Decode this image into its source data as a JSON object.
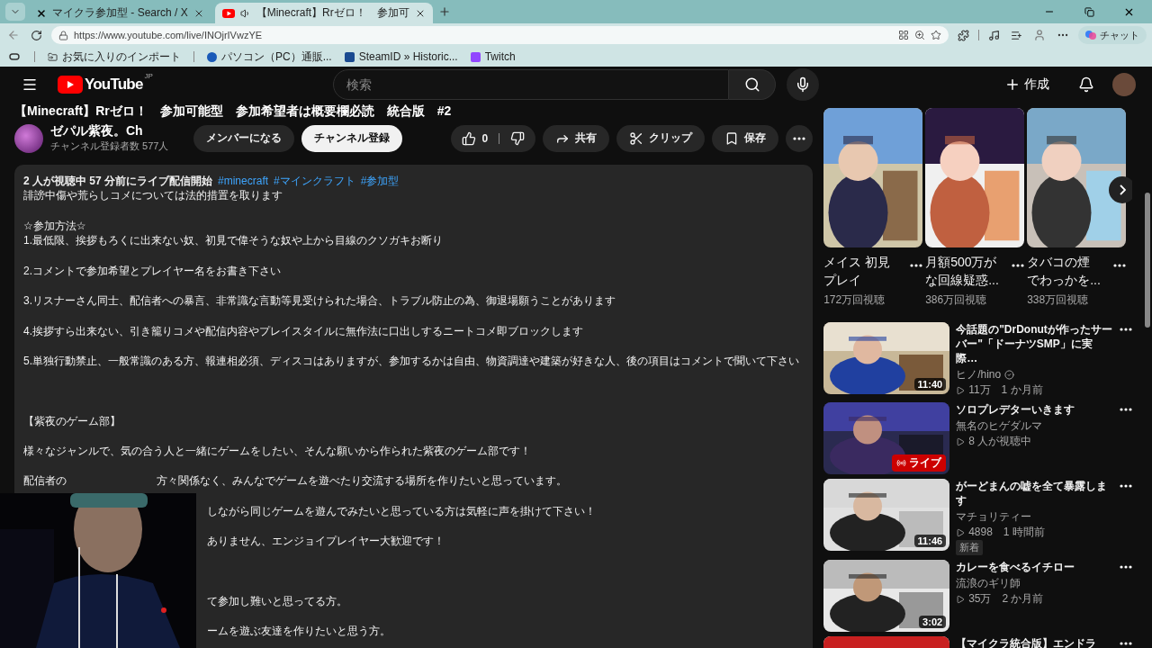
{
  "browser": {
    "tabs": [
      {
        "title": "マイクラ参加型 - Search / X",
        "selected": false,
        "audio": false
      },
      {
        "title": "【Minecraft】Rrゼロ！　参加可",
        "selected": true,
        "audio": true
      }
    ],
    "url": "https://www.youtube.com/live/INOjrIVwzYE",
    "chat_label": "チャット",
    "bookmarks": [
      "お気に入りのインポート",
      "パソコン（PC）通販...",
      "SteamID » Historic...",
      "Twitch"
    ]
  },
  "header": {
    "logo": "YouTube",
    "region": "JP",
    "search_placeholder": "検索",
    "create_label": "作成"
  },
  "video": {
    "title": "【Minecraft】Rrゼロ！　参加可能型　参加希望者は概要欄必読　統合版　#2",
    "channel": "ゼパル紫夜。Ch",
    "subscribers": "チャンネル登録者数 577人",
    "join_label": "メンバーになる",
    "subscribe_label": "チャンネル登録",
    "likes": "0",
    "share_label": "共有",
    "clip_label": "クリップ",
    "save_label": "保存"
  },
  "description": {
    "stats": "2 人が視聴中  57 分前にライブ配信開始",
    "hashtags": [
      "#minecraft",
      "#マインクラフト",
      "#参加型"
    ],
    "paragraphs": [
      {
        "kind": "intro",
        "lines": [
          "誹謗中傷や荒らしコメについては法的措置を取ります"
        ]
      },
      {
        "kind": "paragraph",
        "lines": [
          "☆参加方法☆",
          "1.最低限、挨拶もろくに出来ない奴、初見で偉そうな奴や上から目線のクソガキお断り"
        ]
      },
      {
        "kind": "paragraph",
        "lines": [
          "2.コメントで参加希望とプレイヤー名をお書き下さい"
        ]
      },
      {
        "kind": "paragraph",
        "lines": [
          "3.リスナーさん同士、配信者への暴言、非常識な言動等見受けられた場合、トラブル防止の為、御退場願うことがあります"
        ]
      },
      {
        "kind": "paragraph",
        "lines": [
          "4.挨拶すら出来ない、引き籠りコメや配信内容やプレイスタイルに無作法に口出しするニートコメ即ブロックします"
        ]
      },
      {
        "kind": "paragraph",
        "lines": [
          "5.単独行動禁止、一般常識のある方、報連相必須、ディスコはありますが、参加するかは自由、物資調達や建築が好きな人、後の項目はコメントで聞いて下さい"
        ]
      },
      {
        "kind": "section",
        "lines": [
          "【紫夜のゲーム部】"
        ]
      },
      {
        "kind": "paragraph",
        "lines": [
          "様々なジャンルで、気の合う人と一緒にゲームをしたい、そんな願いから作られた紫夜のゲーム部です！"
        ]
      },
      {
        "kind": "paragraph",
        "lead": "配信者の",
        "lines": [
          "方々関係なく、みんなでゲームを遊べたり交流する場所を作りたいと思っています。"
        ]
      },
      {
        "kind": "camera-paragraph",
        "lines": [
          "しながら同じゲームを遊んでみたいと思っている方は気軽に声を掛けて下さい！"
        ]
      },
      {
        "kind": "camera-paragraph",
        "lines": [
          "ありません、エンジョイプレイヤー大歓迎です！"
        ]
      },
      {
        "kind": "camera-section",
        "lines": [
          "て参加し難いと思ってる方。"
        ]
      },
      {
        "kind": "camera-paragraph",
        "lines": [
          "ームを遊ぶ友達を作りたいと思う方。"
        ]
      }
    ]
  },
  "sidebar": {
    "shorts": [
      {
        "title_lines": [
          "メイス 初見",
          "プレイ"
        ],
        "views": "172万回視聴"
      },
      {
        "title_lines": [
          "月額500万が",
          "な回線疑惑..."
        ],
        "views": "386万回視聴"
      },
      {
        "title_lines": [
          "タバコの煙",
          "でわっかを..."
        ],
        "views": "338万回視聴"
      }
    ],
    "videos": [
      {
        "kind": "video",
        "title": "今話題の\"DrDonutが作ったサーバー\"「ドーナツSMP」に実際…",
        "channel": "ヒノ/hino",
        "verified": true,
        "meta": "11万　1 か月前",
        "duration": "11:40"
      },
      {
        "kind": "live",
        "title": "ソロプレデターいきます",
        "channel": "無名のヒゲダルマ",
        "verified": false,
        "meta": "8 人が視聴中",
        "live_label": "ライブ"
      },
      {
        "kind": "video",
        "title": "がーどまんの嘘を全て暴露します",
        "channel": "マチョリティー",
        "verified": false,
        "meta": "4898　1 時間前",
        "duration": "11:46",
        "badge": "新着"
      },
      {
        "kind": "video",
        "title": "カレーを食べるイチロー",
        "channel": "流浪のギリ師",
        "verified": false,
        "meta": "35万　2 か月前",
        "duration": "3:02"
      },
      {
        "kind": "partial",
        "title": "【マイクラ統合版】エンドラ"
      }
    ]
  }
}
